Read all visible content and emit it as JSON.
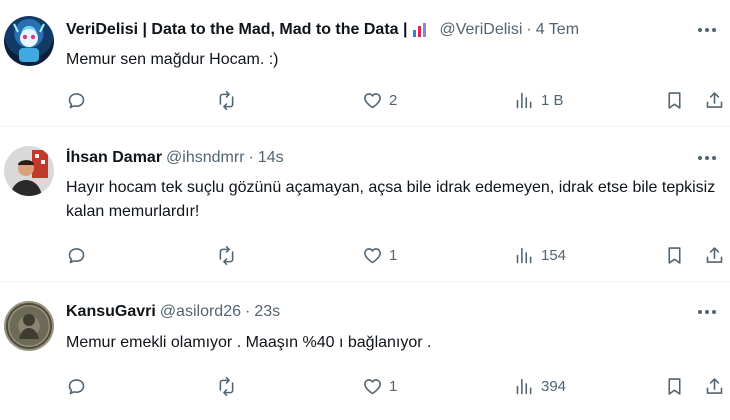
{
  "tweets": [
    {
      "name": "VeriDelisi | Data to the Mad, Mad to the Data |",
      "handle": "@VeriDelisi",
      "separator": "·",
      "time": "4 Tem",
      "text": "Memur sen mağdur Hocam. :)",
      "likes": "2",
      "views": "1 B",
      "avatar_icon": "robot-avatar",
      "badge_icon": "chart-emoji-icon"
    },
    {
      "name": "İhsan Damar",
      "handle": "@ihsndmrr",
      "separator": "·",
      "time": "14s",
      "text": "Hayır hocam tek suçlu gözünü açamayan, açsa bile idrak edemeyen, idrak etse bile tepkisiz kalan memurlardır!",
      "likes": "1",
      "views": "154",
      "avatar_icon": "person-avatar"
    },
    {
      "name": "KansuGavri",
      "handle": "@asilord26",
      "separator": "·",
      "time": "23s",
      "text": "Memur emekli olamıyor . Maaşın %40 ı bağlanıyor .",
      "likes": "1",
      "views": "394",
      "avatar_icon": "coin-avatar"
    }
  ],
  "colors": {
    "text": "#0f1419",
    "secondary": "#536471",
    "divider": "#eff3f4"
  }
}
